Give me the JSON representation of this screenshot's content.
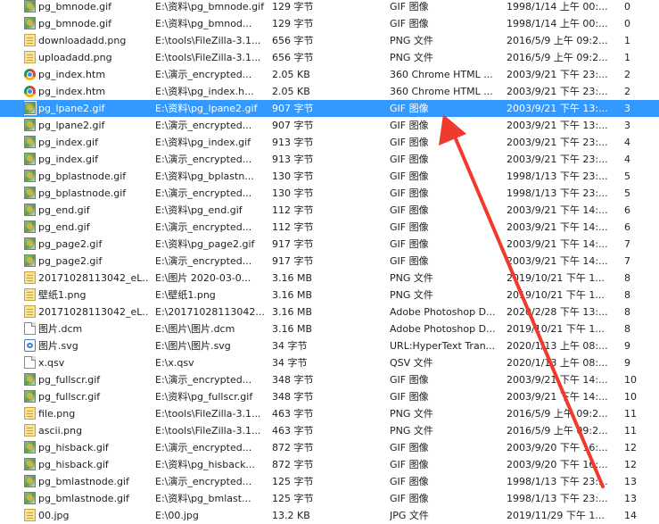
{
  "accent_color": "#3399ff",
  "annotation_color": "#f03a2e",
  "rows": [
    {
      "icon": "image-icon",
      "name": "pg_bmnode.gif",
      "path": "E:\\资料\\pg_bmnode.gif",
      "size": "129 字节",
      "type": "GIF 图像",
      "date": "1998/1/14 上午 00:...",
      "dup": "0"
    },
    {
      "icon": "image-icon",
      "name": "pg_bmnode.gif",
      "path": "E:\\资料\\pg_bmnod...",
      "size": "129 字节",
      "type": "GIF 图像",
      "date": "1998/1/14 上午 00:...",
      "dup": "0"
    },
    {
      "icon": "png-file-icon",
      "name": "downloadadd.png",
      "path": "E:\\tools\\FileZilla-3.1...",
      "size": "656 字节",
      "type": "PNG 文件",
      "date": "2016/5/9 上午 09:2...",
      "dup": "1"
    },
    {
      "icon": "png-file-icon",
      "name": "uploadadd.png",
      "path": "E:\\tools\\FileZilla-3.1...",
      "size": "656 字节",
      "type": "PNG 文件",
      "date": "2016/5/9 上午 09:2...",
      "dup": "1"
    },
    {
      "icon": "chrome-html-icon",
      "name": "pg_index.htm",
      "path": "E:\\演示_encrypted...",
      "size": "2.05 KB",
      "type": "360 Chrome HTML ...",
      "date": "2003/9/21 下午 23:...",
      "dup": "2"
    },
    {
      "icon": "chrome-html-icon",
      "name": "pg_index.htm",
      "path": "E:\\资料\\pg_index.h...",
      "size": "2.05 KB",
      "type": "360 Chrome HTML ...",
      "date": "2003/9/21 下午 23:...",
      "dup": "2"
    },
    {
      "icon": "image-icon",
      "name": "pg_lpane2.gif",
      "path": "E:\\资料\\pg_lpane2.gif",
      "size": "907 字节",
      "type": "GIF 图像",
      "date": "2003/9/21 下午 13:...",
      "dup": "3",
      "selected": true
    },
    {
      "icon": "image-icon",
      "name": "pg_lpane2.gif",
      "path": "E:\\演示_encrypted...",
      "size": "907 字节",
      "type": "GIF 图像",
      "date": "2003/9/21 下午 13:...",
      "dup": "3"
    },
    {
      "icon": "image-icon",
      "name": "pg_index.gif",
      "path": "E:\\资料\\pg_index.gif",
      "size": "913 字节",
      "type": "GIF 图像",
      "date": "2003/9/21 下午 23:...",
      "dup": "4"
    },
    {
      "icon": "image-icon",
      "name": "pg_index.gif",
      "path": "E:\\演示_encrypted...",
      "size": "913 字节",
      "type": "GIF 图像",
      "date": "2003/9/21 下午 23:...",
      "dup": "4"
    },
    {
      "icon": "image-icon",
      "name": "pg_bplastnode.gif",
      "path": "E:\\资料\\pg_bplastn...",
      "size": "130 字节",
      "type": "GIF 图像",
      "date": "1998/1/13 下午 23:...",
      "dup": "5"
    },
    {
      "icon": "image-icon",
      "name": "pg_bplastnode.gif",
      "path": "E:\\演示_encrypted...",
      "size": "130 字节",
      "type": "GIF 图像",
      "date": "1998/1/13 下午 23:...",
      "dup": "5"
    },
    {
      "icon": "image-icon",
      "name": "pg_end.gif",
      "path": "E:\\资料\\pg_end.gif",
      "size": "112 字节",
      "type": "GIF 图像",
      "date": "2003/9/21 下午 14:...",
      "dup": "6"
    },
    {
      "icon": "image-icon",
      "name": "pg_end.gif",
      "path": "E:\\演示_encrypted...",
      "size": "112 字节",
      "type": "GIF 图像",
      "date": "2003/9/21 下午 14:...",
      "dup": "6"
    },
    {
      "icon": "image-icon",
      "name": "pg_page2.gif",
      "path": "E:\\资料\\pg_page2.gif",
      "size": "917 字节",
      "type": "GIF 图像",
      "date": "2003/9/21 下午 14:...",
      "dup": "7"
    },
    {
      "icon": "image-icon",
      "name": "pg_page2.gif",
      "path": "E:\\演示_encrypted...",
      "size": "917 字节",
      "type": "GIF 图像",
      "date": "2003/9/21 下午 14:...",
      "dup": "7"
    },
    {
      "icon": "png-file-icon",
      "name": "20171028113042_eL...",
      "path": "E:\\图片 2020-03-0...",
      "size": "3.16 MB",
      "type": "PNG 文件",
      "date": "2019/10/21 下午 1...",
      "dup": "8"
    },
    {
      "icon": "png-file-icon",
      "name": "壁纸1.png",
      "path": "E:\\壁纸1.png",
      "size": "3.16 MB",
      "type": "PNG 文件",
      "date": "2019/10/21 下午 1...",
      "dup": "8"
    },
    {
      "icon": "png-file-icon",
      "name": "20171028113042_eL...",
      "path": "E:\\20171028113042...",
      "size": "3.16 MB",
      "type": "Adobe Photoshop D...",
      "date": "2020/2/28 下午 13:...",
      "dup": "8"
    },
    {
      "icon": "document-icon",
      "name": "图片.dcm",
      "path": "E:\\图片\\图片.dcm",
      "size": "3.16 MB",
      "type": "Adobe Photoshop D...",
      "date": "2019/10/21 下午 1...",
      "dup": "8"
    },
    {
      "icon": "svg-file-icon",
      "name": "图片.svg",
      "path": "E:\\图片\\图片.svg",
      "size": "34 字节",
      "type": "URL:HyperText Tran...",
      "date": "2020/1/13 上午 08:...",
      "dup": "9"
    },
    {
      "icon": "document-icon",
      "name": "x.qsv",
      "path": "E:\\x.qsv",
      "size": "34 字节",
      "type": "QSV 文件",
      "date": "2020/1/13 上午 08:...",
      "dup": "9"
    },
    {
      "icon": "image-icon",
      "name": "pg_fullscr.gif",
      "path": "E:\\演示_encrypted...",
      "size": "348 字节",
      "type": "GIF 图像",
      "date": "2003/9/21 下午 14:...",
      "dup": "10"
    },
    {
      "icon": "image-icon",
      "name": "pg_fullscr.gif",
      "path": "E:\\资料\\pg_fullscr.gif",
      "size": "348 字节",
      "type": "GIF 图像",
      "date": "2003/9/21 下午 14:...",
      "dup": "10"
    },
    {
      "icon": "png-file-icon",
      "name": "file.png",
      "path": "E:\\tools\\FileZilla-3.1...",
      "size": "463 字节",
      "type": "PNG 文件",
      "date": "2016/5/9 上午 09:2...",
      "dup": "11"
    },
    {
      "icon": "png-file-icon",
      "name": "ascii.png",
      "path": "E:\\tools\\FileZilla-3.1...",
      "size": "463 字节",
      "type": "PNG 文件",
      "date": "2016/5/9 上午 09:2...",
      "dup": "11"
    },
    {
      "icon": "image-icon",
      "name": "pg_hisback.gif",
      "path": "E:\\演示_encrypted...",
      "size": "872 字节",
      "type": "GIF 图像",
      "date": "2003/9/20 下午 16:...",
      "dup": "12"
    },
    {
      "icon": "image-icon",
      "name": "pg_hisback.gif",
      "path": "E:\\资料\\pg_hisback...",
      "size": "872 字节",
      "type": "GIF 图像",
      "date": "2003/9/20 下午 16:...",
      "dup": "12"
    },
    {
      "icon": "image-icon",
      "name": "pg_bmlastnode.gif",
      "path": "E:\\演示_encrypted...",
      "size": "125 字节",
      "type": "GIF 图像",
      "date": "1998/1/13 下午 23:...",
      "dup": "13"
    },
    {
      "icon": "image-icon",
      "name": "pg_bmlastnode.gif",
      "path": "E:\\资料\\pg_bmlast...",
      "size": "125 字节",
      "type": "GIF 图像",
      "date": "1998/1/13 下午 23:...",
      "dup": "13"
    },
    {
      "icon": "png-file-icon",
      "name": "00.jpg",
      "path": "E:\\00.jpg",
      "size": "13.2 KB",
      "type": "JPG 文件",
      "date": "2019/11/29 下午 1...",
      "dup": "14"
    }
  ]
}
